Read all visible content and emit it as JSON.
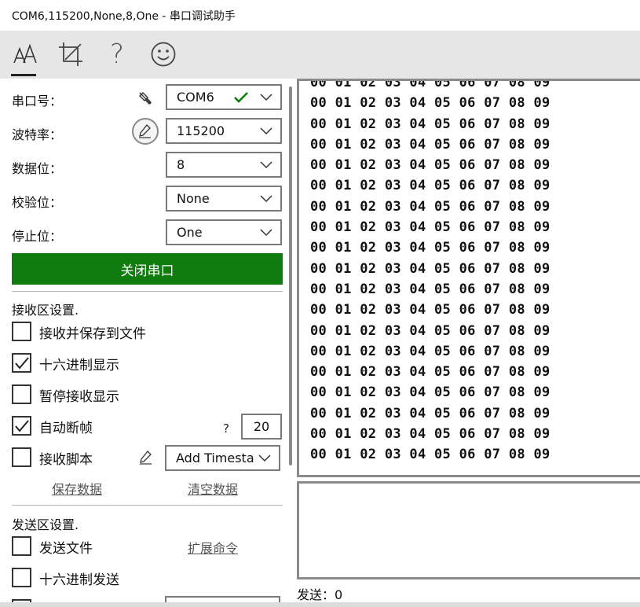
{
  "window": {
    "title": "COM6,115200,None,8,One - 串口调试助手"
  },
  "toolbar": {
    "icons": [
      "font-icon",
      "crop-icon",
      "help-icon",
      "smiley-icon"
    ],
    "help_glyph": "?"
  },
  "serial": {
    "port_label": "串口号：",
    "port_value": "COM6",
    "baud_label": "波特率：",
    "baud_value": "115200",
    "databits_label": "数据位：",
    "databits_value": "8",
    "parity_label": "校验位：",
    "parity_value": "None",
    "stopbits_label": "停止位：",
    "stopbits_value": "One",
    "close_button": "关闭串口",
    "accent_color": "#107c10"
  },
  "receive_settings": {
    "title": "接收区设置.",
    "save_to_file": {
      "label": "接收并保存到文件",
      "checked": false
    },
    "hex_display": {
      "label": "十六进制显示",
      "checked": true
    },
    "pause_display": {
      "label": "暂停接收显示",
      "checked": false
    },
    "auto_frame": {
      "label": "自动断帧",
      "checked": true
    },
    "frame_help": "?",
    "frame_value": "20",
    "script": {
      "label": "接收脚本",
      "checked": false
    },
    "script_value": "Add Timesta",
    "save_data": "保存数据",
    "clear_data": "清空数据"
  },
  "send_settings": {
    "title": "发送区设置.",
    "send_file": {
      "label": "发送文件",
      "checked": false
    },
    "extend_cmd": "扩展命令",
    "hex_send": {
      "label": "十六进制发送",
      "checked": false
    }
  },
  "receive_area": {
    "lines": [
      "00 01 02 03 04 05 06 07 08 09",
      "00 01 02 03 04 05 06 07 08 09",
      "00 01 02 03 04 05 06 07 08 09",
      "00 01 02 03 04 05 06 07 08 09",
      "00 01 02 03 04 05 06 07 08 09",
      "00 01 02 03 04 05 06 07 08 09",
      "00 01 02 03 04 05 06 07 08 09",
      "00 01 02 03 04 05 06 07 08 09",
      "00 01 02 03 04 05 06 07 08 09",
      "00 01 02 03 04 05 06 07 08 09",
      "00 01 02 03 04 05 06 07 08 09",
      "00 01 02 03 04 05 06 07 08 09",
      "00 01 02 03 04 05 06 07 08 09",
      "00 01 02 03 04 05 06 07 08 09",
      "00 01 02 03 04 05 06 07 08 09",
      "00 01 02 03 04 05 06 07 08 09",
      "00 01 02 03 04 05 06 07 08 09",
      "00 01 02 03 04 05 06 07 08 09",
      "00 01 02 03 04 05 06 07 08 09"
    ]
  },
  "status": {
    "sent": "发送：0"
  }
}
